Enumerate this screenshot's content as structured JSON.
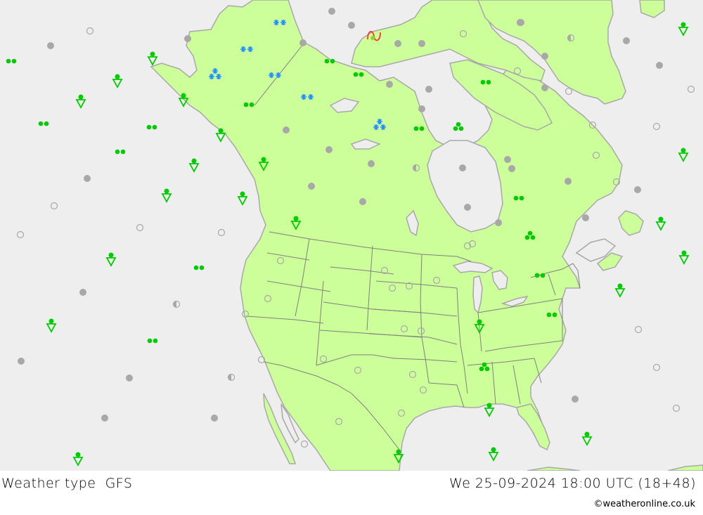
{
  "header": {
    "title": "Weather type",
    "model": "GFS",
    "datetime": "We 25-09-2024 18:00 UTC (18+48)",
    "copyright": "©weatheronline.co.uk"
  },
  "colors": {
    "ocean": "#eeeeee",
    "land": "#ccff99",
    "coast": "#a8a8a8",
    "border": "#808080",
    "rain": "#00cc00",
    "snow": "#1e90ff",
    "cloud": "#a8a8a8",
    "thunder": "#ff3333"
  },
  "symbols": [
    {
      "type": "snow-pair",
      "region": "Alaska north"
    },
    {
      "type": "snow-pair",
      "region": "Alaska interior"
    },
    {
      "type": "snow-triple",
      "region": "Alaska south"
    },
    {
      "type": "snow-pair",
      "region": "Alaska east"
    },
    {
      "type": "snow-pair",
      "region": "Yukon"
    },
    {
      "type": "snow-triple",
      "region": "Nunavut"
    },
    {
      "type": "thunderstorm",
      "region": "Arctic archipelago"
    },
    {
      "type": "rain-pair",
      "region": "North Pacific"
    },
    {
      "type": "rain-pair",
      "region": "North Pacific"
    },
    {
      "type": "rain-pair",
      "region": "North Pacific"
    },
    {
      "type": "rain-pair",
      "region": "North Pacific"
    },
    {
      "type": "rain-pair",
      "region": "Pacific"
    },
    {
      "type": "rain-pair",
      "region": "Pacific"
    },
    {
      "type": "rain-pair",
      "region": "Beaufort coast"
    },
    {
      "type": "rain-pair",
      "region": "Beaufort coast"
    },
    {
      "type": "rain-pair",
      "region": "BC coast"
    },
    {
      "type": "rain-pair",
      "region": "Hudson Bay west"
    },
    {
      "type": "rain-pair",
      "region": "Baffin"
    },
    {
      "type": "rain-pair",
      "region": "Quebec"
    },
    {
      "type": "rain-pair",
      "region": "Ontario"
    },
    {
      "type": "rain-pair",
      "region": "Pennsylvania"
    },
    {
      "type": "rain-triple",
      "region": "Foxe Basin"
    },
    {
      "type": "rain-triple",
      "region": "Quebec"
    },
    {
      "type": "rain-triple",
      "region": "Alabama"
    },
    {
      "type": "rain-shower",
      "region": "Pacific"
    },
    {
      "type": "rain-shower",
      "region": "Atlantic"
    },
    {
      "type": "rain-shower",
      "region": "Indiana"
    },
    {
      "type": "rain-shower",
      "region": "Gulf coast"
    },
    {
      "type": "rain-shower",
      "region": "Texas"
    },
    {
      "type": "rain-shower",
      "region": "Bahamas"
    }
  ]
}
